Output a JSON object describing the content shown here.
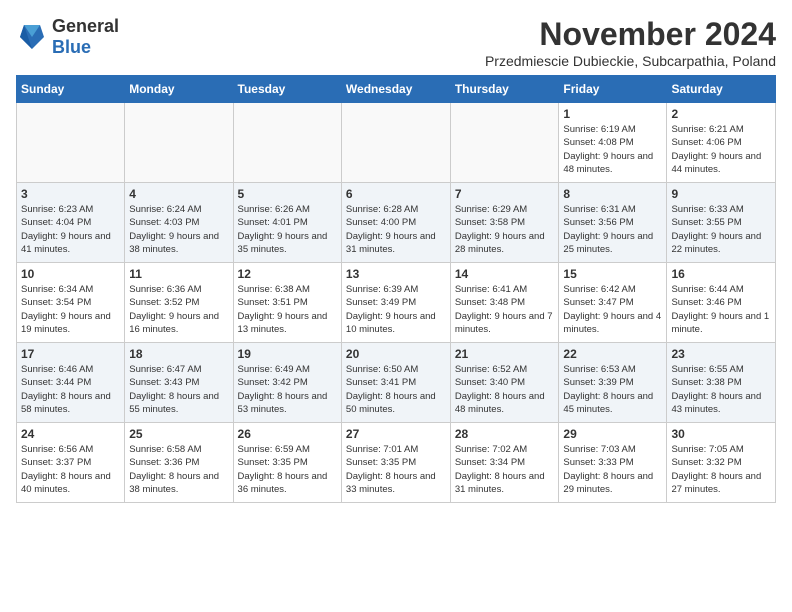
{
  "logo": {
    "general": "General",
    "blue": "Blue"
  },
  "title": "November 2024",
  "location": "Przedmiescie Dubieckie, Subcarpathia, Poland",
  "days_of_week": [
    "Sunday",
    "Monday",
    "Tuesday",
    "Wednesday",
    "Thursday",
    "Friday",
    "Saturday"
  ],
  "weeks": [
    [
      {
        "day": "",
        "info": ""
      },
      {
        "day": "",
        "info": ""
      },
      {
        "day": "",
        "info": ""
      },
      {
        "day": "",
        "info": ""
      },
      {
        "day": "",
        "info": ""
      },
      {
        "day": "1",
        "info": "Sunrise: 6:19 AM\nSunset: 4:08 PM\nDaylight: 9 hours and 48 minutes."
      },
      {
        "day": "2",
        "info": "Sunrise: 6:21 AM\nSunset: 4:06 PM\nDaylight: 9 hours and 44 minutes."
      }
    ],
    [
      {
        "day": "3",
        "info": "Sunrise: 6:23 AM\nSunset: 4:04 PM\nDaylight: 9 hours and 41 minutes."
      },
      {
        "day": "4",
        "info": "Sunrise: 6:24 AM\nSunset: 4:03 PM\nDaylight: 9 hours and 38 minutes."
      },
      {
        "day": "5",
        "info": "Sunrise: 6:26 AM\nSunset: 4:01 PM\nDaylight: 9 hours and 35 minutes."
      },
      {
        "day": "6",
        "info": "Sunrise: 6:28 AM\nSunset: 4:00 PM\nDaylight: 9 hours and 31 minutes."
      },
      {
        "day": "7",
        "info": "Sunrise: 6:29 AM\nSunset: 3:58 PM\nDaylight: 9 hours and 28 minutes."
      },
      {
        "day": "8",
        "info": "Sunrise: 6:31 AM\nSunset: 3:56 PM\nDaylight: 9 hours and 25 minutes."
      },
      {
        "day": "9",
        "info": "Sunrise: 6:33 AM\nSunset: 3:55 PM\nDaylight: 9 hours and 22 minutes."
      }
    ],
    [
      {
        "day": "10",
        "info": "Sunrise: 6:34 AM\nSunset: 3:54 PM\nDaylight: 9 hours and 19 minutes."
      },
      {
        "day": "11",
        "info": "Sunrise: 6:36 AM\nSunset: 3:52 PM\nDaylight: 9 hours and 16 minutes."
      },
      {
        "day": "12",
        "info": "Sunrise: 6:38 AM\nSunset: 3:51 PM\nDaylight: 9 hours and 13 minutes."
      },
      {
        "day": "13",
        "info": "Sunrise: 6:39 AM\nSunset: 3:49 PM\nDaylight: 9 hours and 10 minutes."
      },
      {
        "day": "14",
        "info": "Sunrise: 6:41 AM\nSunset: 3:48 PM\nDaylight: 9 hours and 7 minutes."
      },
      {
        "day": "15",
        "info": "Sunrise: 6:42 AM\nSunset: 3:47 PM\nDaylight: 9 hours and 4 minutes."
      },
      {
        "day": "16",
        "info": "Sunrise: 6:44 AM\nSunset: 3:46 PM\nDaylight: 9 hours and 1 minute."
      }
    ],
    [
      {
        "day": "17",
        "info": "Sunrise: 6:46 AM\nSunset: 3:44 PM\nDaylight: 8 hours and 58 minutes."
      },
      {
        "day": "18",
        "info": "Sunrise: 6:47 AM\nSunset: 3:43 PM\nDaylight: 8 hours and 55 minutes."
      },
      {
        "day": "19",
        "info": "Sunrise: 6:49 AM\nSunset: 3:42 PM\nDaylight: 8 hours and 53 minutes."
      },
      {
        "day": "20",
        "info": "Sunrise: 6:50 AM\nSunset: 3:41 PM\nDaylight: 8 hours and 50 minutes."
      },
      {
        "day": "21",
        "info": "Sunrise: 6:52 AM\nSunset: 3:40 PM\nDaylight: 8 hours and 48 minutes."
      },
      {
        "day": "22",
        "info": "Sunrise: 6:53 AM\nSunset: 3:39 PM\nDaylight: 8 hours and 45 minutes."
      },
      {
        "day": "23",
        "info": "Sunrise: 6:55 AM\nSunset: 3:38 PM\nDaylight: 8 hours and 43 minutes."
      }
    ],
    [
      {
        "day": "24",
        "info": "Sunrise: 6:56 AM\nSunset: 3:37 PM\nDaylight: 8 hours and 40 minutes."
      },
      {
        "day": "25",
        "info": "Sunrise: 6:58 AM\nSunset: 3:36 PM\nDaylight: 8 hours and 38 minutes."
      },
      {
        "day": "26",
        "info": "Sunrise: 6:59 AM\nSunset: 3:35 PM\nDaylight: 8 hours and 36 minutes."
      },
      {
        "day": "27",
        "info": "Sunrise: 7:01 AM\nSunset: 3:35 PM\nDaylight: 8 hours and 33 minutes."
      },
      {
        "day": "28",
        "info": "Sunrise: 7:02 AM\nSunset: 3:34 PM\nDaylight: 8 hours and 31 minutes."
      },
      {
        "day": "29",
        "info": "Sunrise: 7:03 AM\nSunset: 3:33 PM\nDaylight: 8 hours and 29 minutes."
      },
      {
        "day": "30",
        "info": "Sunrise: 7:05 AM\nSunset: 3:32 PM\nDaylight: 8 hours and 27 minutes."
      }
    ]
  ]
}
